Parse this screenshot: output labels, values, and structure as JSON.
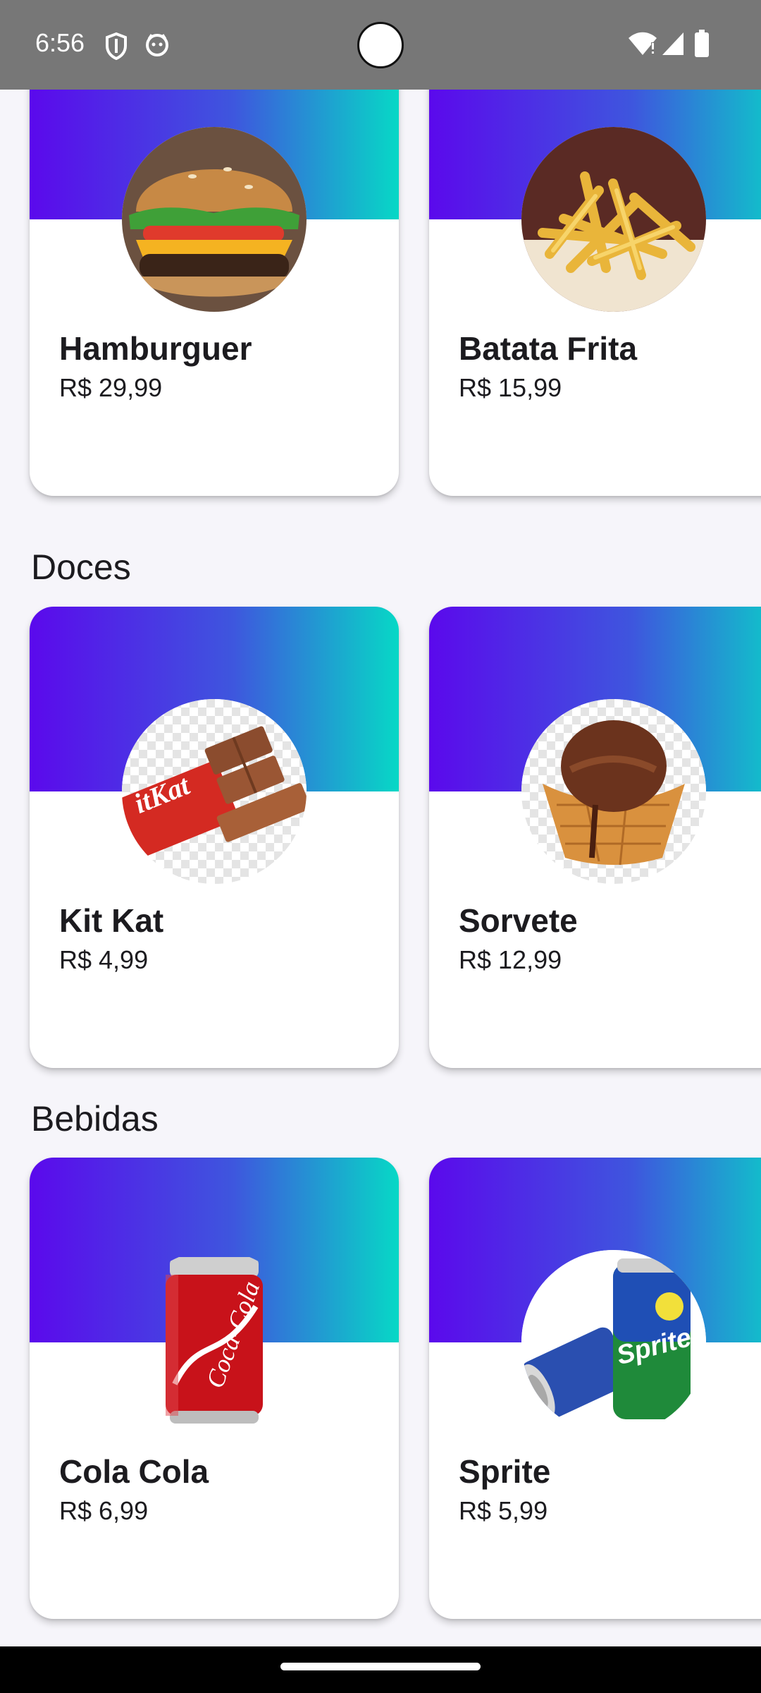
{
  "status_bar": {
    "time": "6:56",
    "left_icons": [
      "shield-icon",
      "notification-face-icon"
    ],
    "right_icons": [
      "wifi-alert-icon",
      "signal-icon",
      "battery-icon"
    ],
    "background_color": "#777777"
  },
  "theme": {
    "banner_gradient": [
      "#5b09ec",
      "#3e56de",
      "#07d8c6"
    ],
    "page_background": "#f6f5fa"
  },
  "sections": [
    {
      "title": "",
      "items": [
        {
          "name": "Hamburguer",
          "price": "R$ 29,99",
          "image": "hamburger-image"
        },
        {
          "name": "Batata Frita",
          "price": "R$ 15,99",
          "image": "french-fries-image"
        }
      ]
    },
    {
      "title": "Doces",
      "items": [
        {
          "name": "Kit Kat",
          "price": "R$ 4,99",
          "image": "kitkat-image"
        },
        {
          "name": "Sorvete",
          "price": "R$ 12,99",
          "image": "ice-cream-image"
        }
      ]
    },
    {
      "title": "Bebidas",
      "items": [
        {
          "name": "Cola Cola",
          "price": "R$ 6,99",
          "image": "cola-can-image"
        },
        {
          "name": "Sprite",
          "price": "R$ 5,99",
          "image": "sprite-cans-image"
        }
      ]
    }
  ]
}
